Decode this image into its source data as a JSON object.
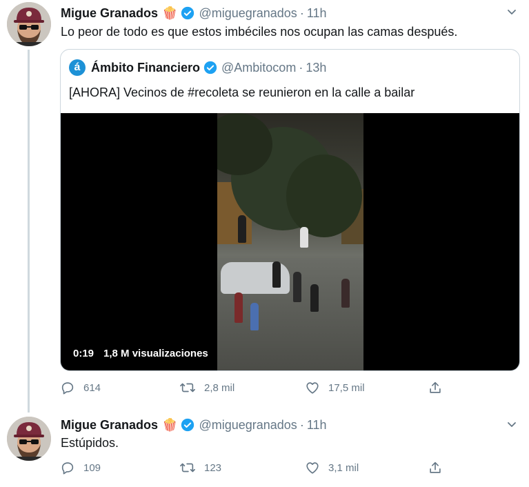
{
  "tweets": [
    {
      "author": {
        "name": "Migue Granados",
        "emoji": "🍿",
        "handle": "@miguegranados",
        "time": "11h",
        "verified": true
      },
      "text": "Lo peor de todo es que estos imbéciles nos ocupan las camas después.",
      "quoted": {
        "author": {
          "name": "Ámbito Financiero",
          "handle": "@Ambitocom",
          "time": "13h",
          "verified": true,
          "avatar_letter": "á"
        },
        "text": "[AHORA] Vecinos de #recoleta se reunieron en la calle a bailar",
        "video": {
          "duration": "0:19",
          "views": "1,8 M visualizaciones"
        }
      },
      "stats": {
        "replies": "614",
        "retweets": "2,8 mil",
        "likes": "17,5 mil"
      }
    },
    {
      "author": {
        "name": "Migue Granados",
        "emoji": "🍿",
        "handle": "@miguegranados",
        "time": "11h",
        "verified": true
      },
      "text": "Estúpidos.",
      "stats": {
        "replies": "109",
        "retweets": "123",
        "likes": "3,1 mil"
      }
    }
  ],
  "separator": "·",
  "icons": {
    "verified": "verified-badge-icon",
    "caret": "chevron-down-icon",
    "reply": "reply-icon",
    "retweet": "retweet-icon",
    "like": "heart-icon",
    "share": "share-icon"
  },
  "colors": {
    "verified": "#1da1f2",
    "muted": "#657786",
    "text": "#14171a",
    "border": "#ccd6dd",
    "ambito_brand": "#1d91d6"
  }
}
